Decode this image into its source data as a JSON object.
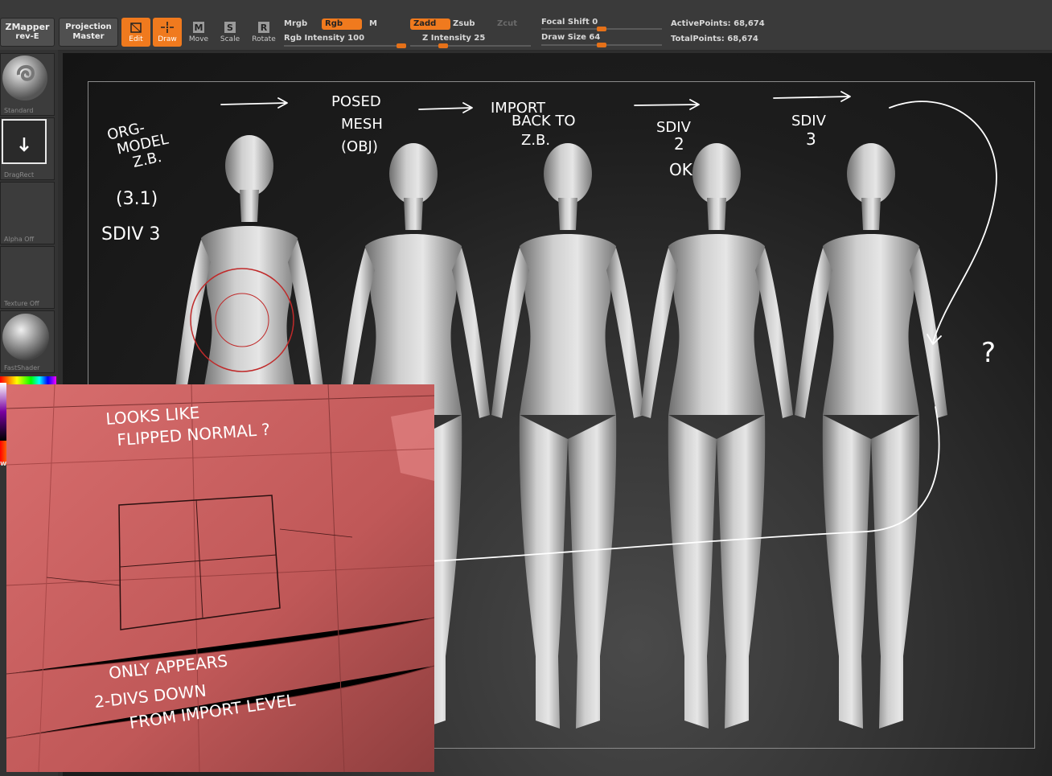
{
  "toolbar": {
    "zmapper_label": "ZMapper",
    "zmapper_sub": "rev-E",
    "projection_label": "Projection",
    "projection_sub": "Master",
    "edit_label": "Edit",
    "draw_label": "Draw",
    "move_label": "Move",
    "scale_label": "Scale",
    "rotate_label": "Rotate",
    "mrgb_label": "Mrgb",
    "rgb_label": "Rgb",
    "m_label": "M",
    "zadd_label": "Zadd",
    "zsub_label": "Zsub",
    "zcut_label": "Zcut",
    "rgb_intensity_label": "Rgb Intensity 100",
    "z_intensity_label": "Z Intensity 25",
    "focal_shift_label": "Focal Shift",
    "focal_shift_value": "0",
    "draw_size_label": "Draw Size",
    "draw_size_value": "64",
    "active_points_label": "ActivePoints: 68,674",
    "total_points_label": "TotalPoints: 68,674",
    "rgb_intensity": 100,
    "z_intensity": 25,
    "focal_shift": 0,
    "draw_size": 64
  },
  "sidebar": {
    "tiles": [
      {
        "caption": "Standard",
        "icon": "brush-standard-icon"
      },
      {
        "caption": "DragRect",
        "icon": "drag-rect-icon"
      },
      {
        "caption": "Alpha Off",
        "icon": "alpha-icon"
      },
      {
        "caption": "Texture Off",
        "icon": "texture-icon"
      },
      {
        "caption": "FastShader",
        "icon": "material-sphere-icon"
      }
    ],
    "partial_label": "w"
  },
  "annotations": {
    "col1": [
      "ORG-",
      "MODEL",
      "Z.B."
    ],
    "col1_paren": "(3.1)",
    "col1_sdiv": "SDIV 3",
    "col2": [
      "POSED",
      "MESH",
      "(OBJ)"
    ],
    "col3": [
      "IMPORT",
      "BACK TO",
      "Z.B."
    ],
    "col4": [
      "SDIV",
      "2",
      "OK"
    ],
    "col5": [
      "SDIV",
      "3"
    ],
    "question": "?"
  },
  "inset": {
    "line1": "LOOKS LIKE",
    "line2": "FLIPPED NORMAL ?",
    "line3": "ONLY APPEARS",
    "line4": "2-DIVS DOWN",
    "line5": "FROM IMPORT LEVEL"
  },
  "colors": {
    "accent": "#f07a1e",
    "toolbar_bg": "#3a3a3a",
    "inset_red": "#c65a5a"
  }
}
